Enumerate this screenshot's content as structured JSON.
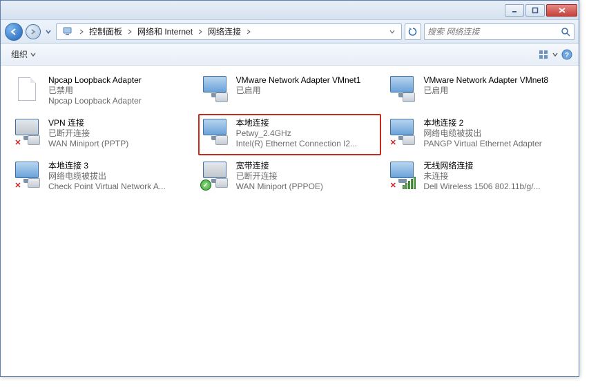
{
  "window": {
    "minimize": "_",
    "maximize": "□",
    "close": "×"
  },
  "breadcrumb": {
    "root_icon": "computer",
    "items": [
      "控制面板",
      "网络和 Internet",
      "网络连接"
    ]
  },
  "search": {
    "placeholder": "搜索 网络连接"
  },
  "toolbar": {
    "organize": "组织"
  },
  "connections": [
    {
      "id": "npcap",
      "title": "Npcap Loopback Adapter",
      "status": "已禁用",
      "device": "Npcap Loopback Adapter",
      "icon": "page",
      "badge": "",
      "selected": false
    },
    {
      "id": "vmnet1",
      "title": "VMware Network Adapter VMnet1",
      "status": "已启用",
      "device": "",
      "icon": "monitor",
      "badge": "",
      "selected": false
    },
    {
      "id": "vmnet8",
      "title": "VMware Network Adapter VMnet8",
      "status": "已启用",
      "device": "",
      "icon": "monitor",
      "badge": "",
      "selected": false
    },
    {
      "id": "vpn",
      "title": "VPN 连接",
      "status": "已断开连接",
      "device": "WAN Miniport (PPTP)",
      "icon": "monitor-gray",
      "badge": "x",
      "selected": false
    },
    {
      "id": "local",
      "title": "本地连接",
      "status": "Petwy_2.4GHz",
      "device": "Intel(R) Ethernet Connection I2...",
      "icon": "monitor",
      "badge": "",
      "selected": true
    },
    {
      "id": "local2",
      "title": "本地连接 2",
      "status": "网络电缆被拔出",
      "device": "PANGP Virtual Ethernet Adapter",
      "icon": "monitor",
      "badge": "x",
      "selected": false
    },
    {
      "id": "local3",
      "title": "本地连接 3",
      "status": "网络电缆被拔出",
      "device": "Check Point Virtual Network A...",
      "icon": "monitor",
      "badge": "x",
      "selected": false
    },
    {
      "id": "broadband",
      "title": "宽带连接",
      "status": "已断开连接",
      "device": "WAN Miniport (PPPOE)",
      "icon": "monitor-gray",
      "badge": "ok",
      "selected": false
    },
    {
      "id": "wireless",
      "title": "无线网络连接",
      "status": "未连接",
      "device": "Dell Wireless 1506 802.11b/g/...",
      "icon": "monitor-signal",
      "badge": "x",
      "selected": false
    }
  ]
}
